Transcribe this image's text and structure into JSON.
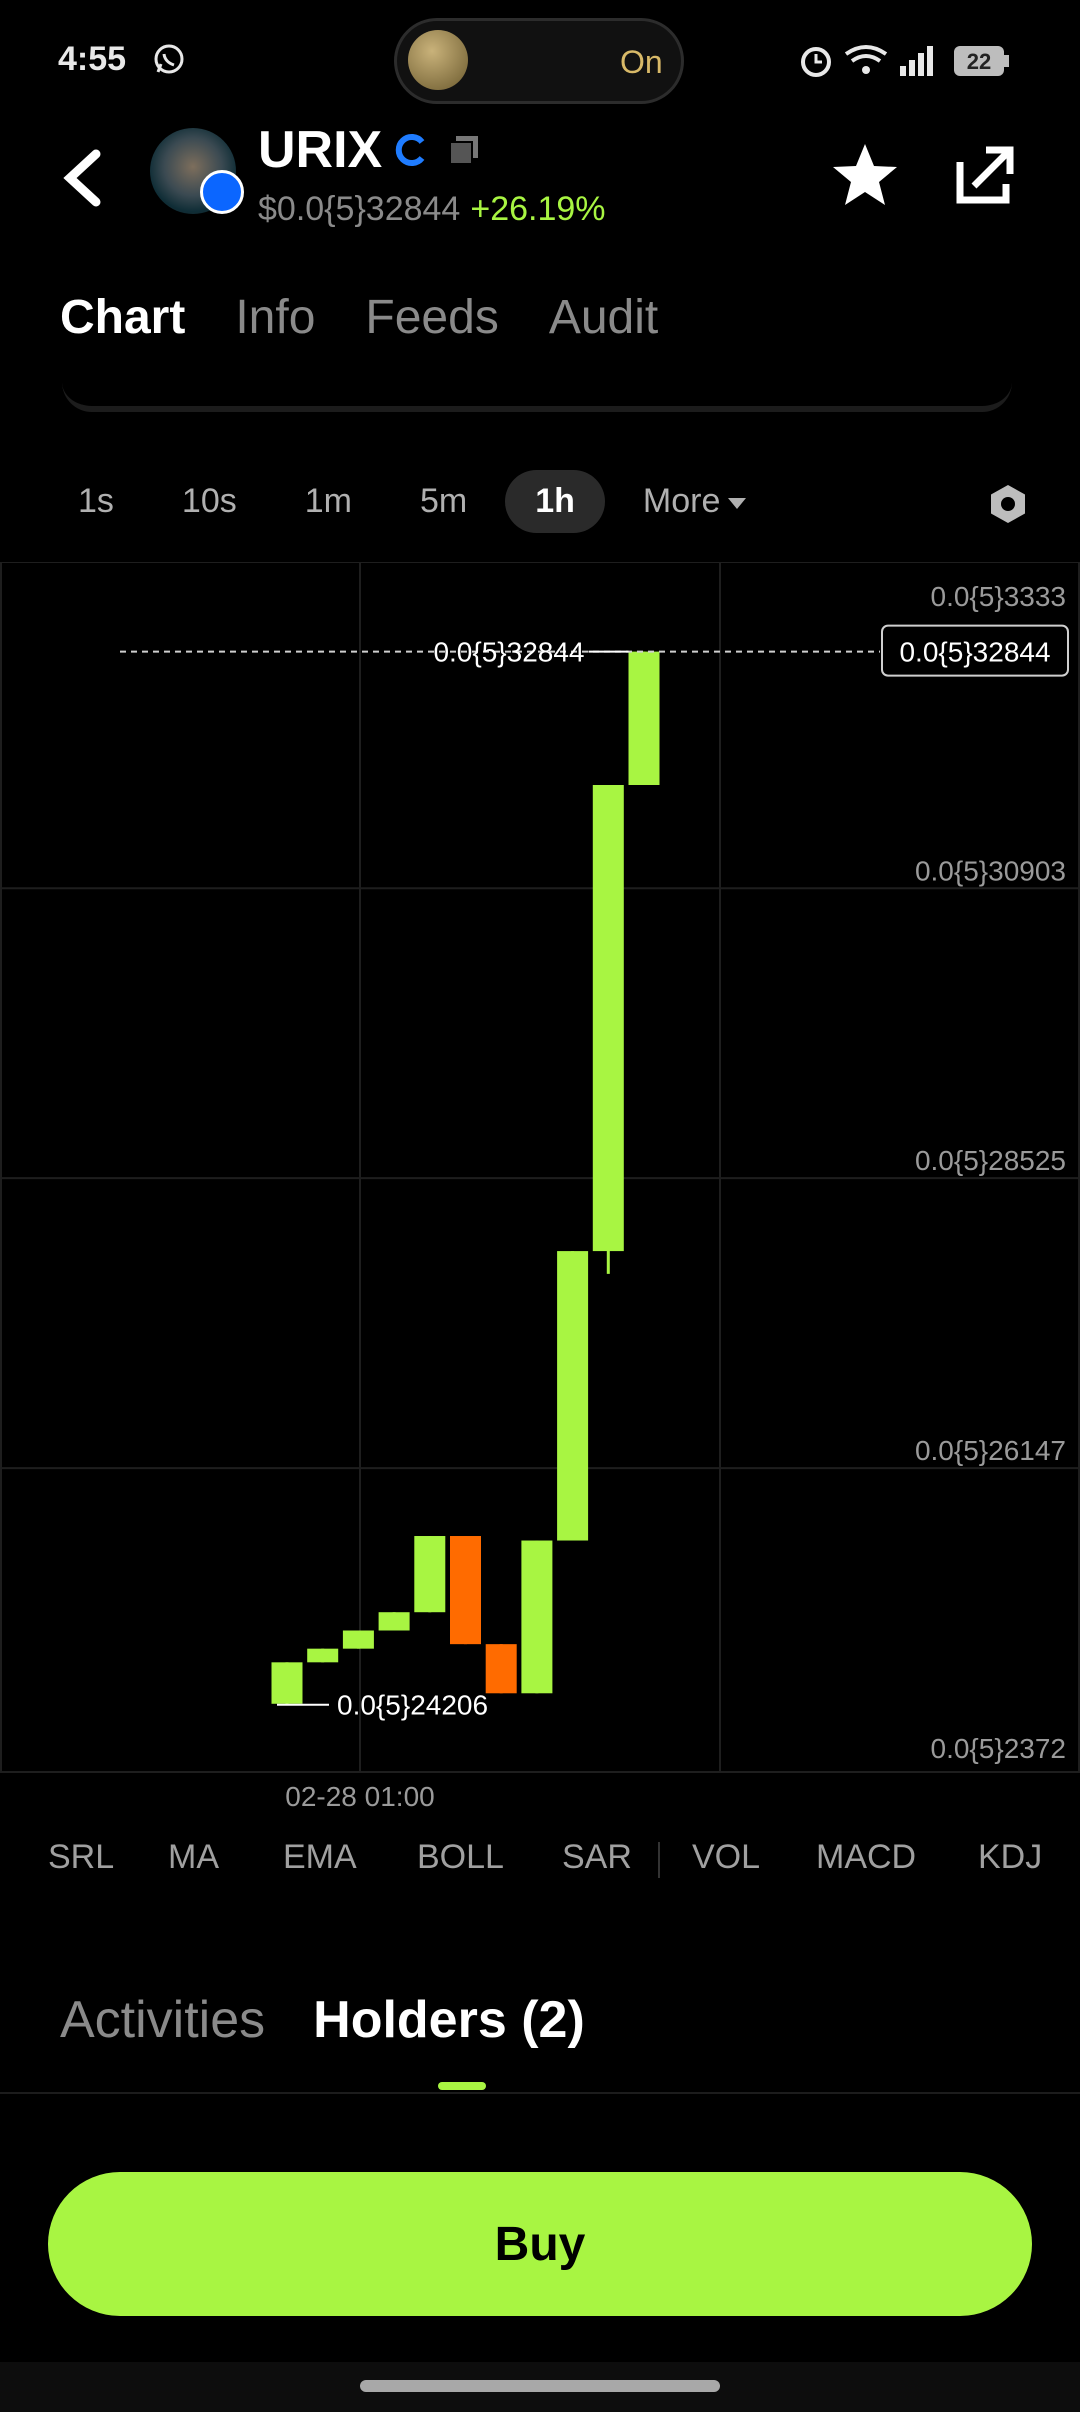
{
  "status_bar": {
    "time": "4:55",
    "flashlight_label": "On",
    "battery": "22"
  },
  "header": {
    "token_name": "URIX",
    "price": "$0.0{5}32844",
    "change": "+26.19%"
  },
  "tabs": [
    {
      "label": "Chart",
      "active": true
    },
    {
      "label": "Info",
      "active": false
    },
    {
      "label": "Feeds",
      "active": false
    },
    {
      "label": "Audit",
      "active": false
    }
  ],
  "intervals": [
    {
      "label": "1s",
      "active": false
    },
    {
      "label": "10s",
      "active": false
    },
    {
      "label": "1m",
      "active": false
    },
    {
      "label": "5m",
      "active": false
    },
    {
      "label": "1h",
      "active": true
    }
  ],
  "more_label": "More",
  "chart_data": {
    "type": "candlestick",
    "y_axis_labels": [
      "0.0{5}3333",
      "0.0{5}30903",
      "0.0{5}28525",
      "0.0{5}26147",
      "0.0{5}2372"
    ],
    "y_axis_values": [
      3.3333,
      3.0903,
      2.8525,
      2.6147,
      2.372
    ],
    "ylim": [
      2.372,
      3.3333
    ],
    "x_tick_label": "02-28 01:00",
    "current_price_label": "0.0{5}32844",
    "current_price_value": 3.2844,
    "high_label": "0.0{5}32844",
    "low_label": "0.0{5}24206",
    "low_value": 2.4206,
    "colors": {
      "up": "#a8f542",
      "down": "#ff6b00"
    },
    "candles": [
      {
        "open": 2.4214,
        "close": 2.4554,
        "high": 2.4554,
        "low": 2.4206,
        "dir": "up"
      },
      {
        "open": 2.4554,
        "close": 2.4666,
        "high": 2.4666,
        "low": 2.4554,
        "dir": "up"
      },
      {
        "open": 2.4666,
        "close": 2.4815,
        "high": 2.4815,
        "low": 2.4666,
        "dir": "up"
      },
      {
        "open": 2.4815,
        "close": 2.4965,
        "high": 2.4965,
        "low": 2.4815,
        "dir": "up"
      },
      {
        "open": 2.4965,
        "close": 2.559,
        "high": 2.559,
        "low": 2.4965,
        "dir": "up"
      },
      {
        "open": 2.559,
        "close": 2.4703,
        "high": 2.559,
        "low": 2.4703,
        "dir": "down"
      },
      {
        "open": 2.4703,
        "close": 2.43,
        "high": 2.4703,
        "low": 2.43,
        "dir": "down"
      },
      {
        "open": 2.43,
        "close": 2.5553,
        "high": 2.5553,
        "low": 2.43,
        "dir": "up"
      },
      {
        "open": 2.5553,
        "close": 2.7927,
        "high": 2.7927,
        "low": 2.5553,
        "dir": "up"
      },
      {
        "open": 2.7927,
        "close": 3.175,
        "high": 3.175,
        "low": 2.774,
        "dir": "up"
      },
      {
        "open": 3.175,
        "close": 3.2844,
        "high": 3.2844,
        "low": 3.175,
        "dir": "up"
      }
    ]
  },
  "indicators": [
    "SRL",
    "MA",
    "EMA",
    "BOLL",
    "SAR",
    "VOL",
    "MACD",
    "KDJ"
  ],
  "bottom_tabs": [
    {
      "label": "Activities",
      "active": false
    },
    {
      "label": "Holders (2)",
      "active": true
    }
  ],
  "buy_label": "Buy"
}
